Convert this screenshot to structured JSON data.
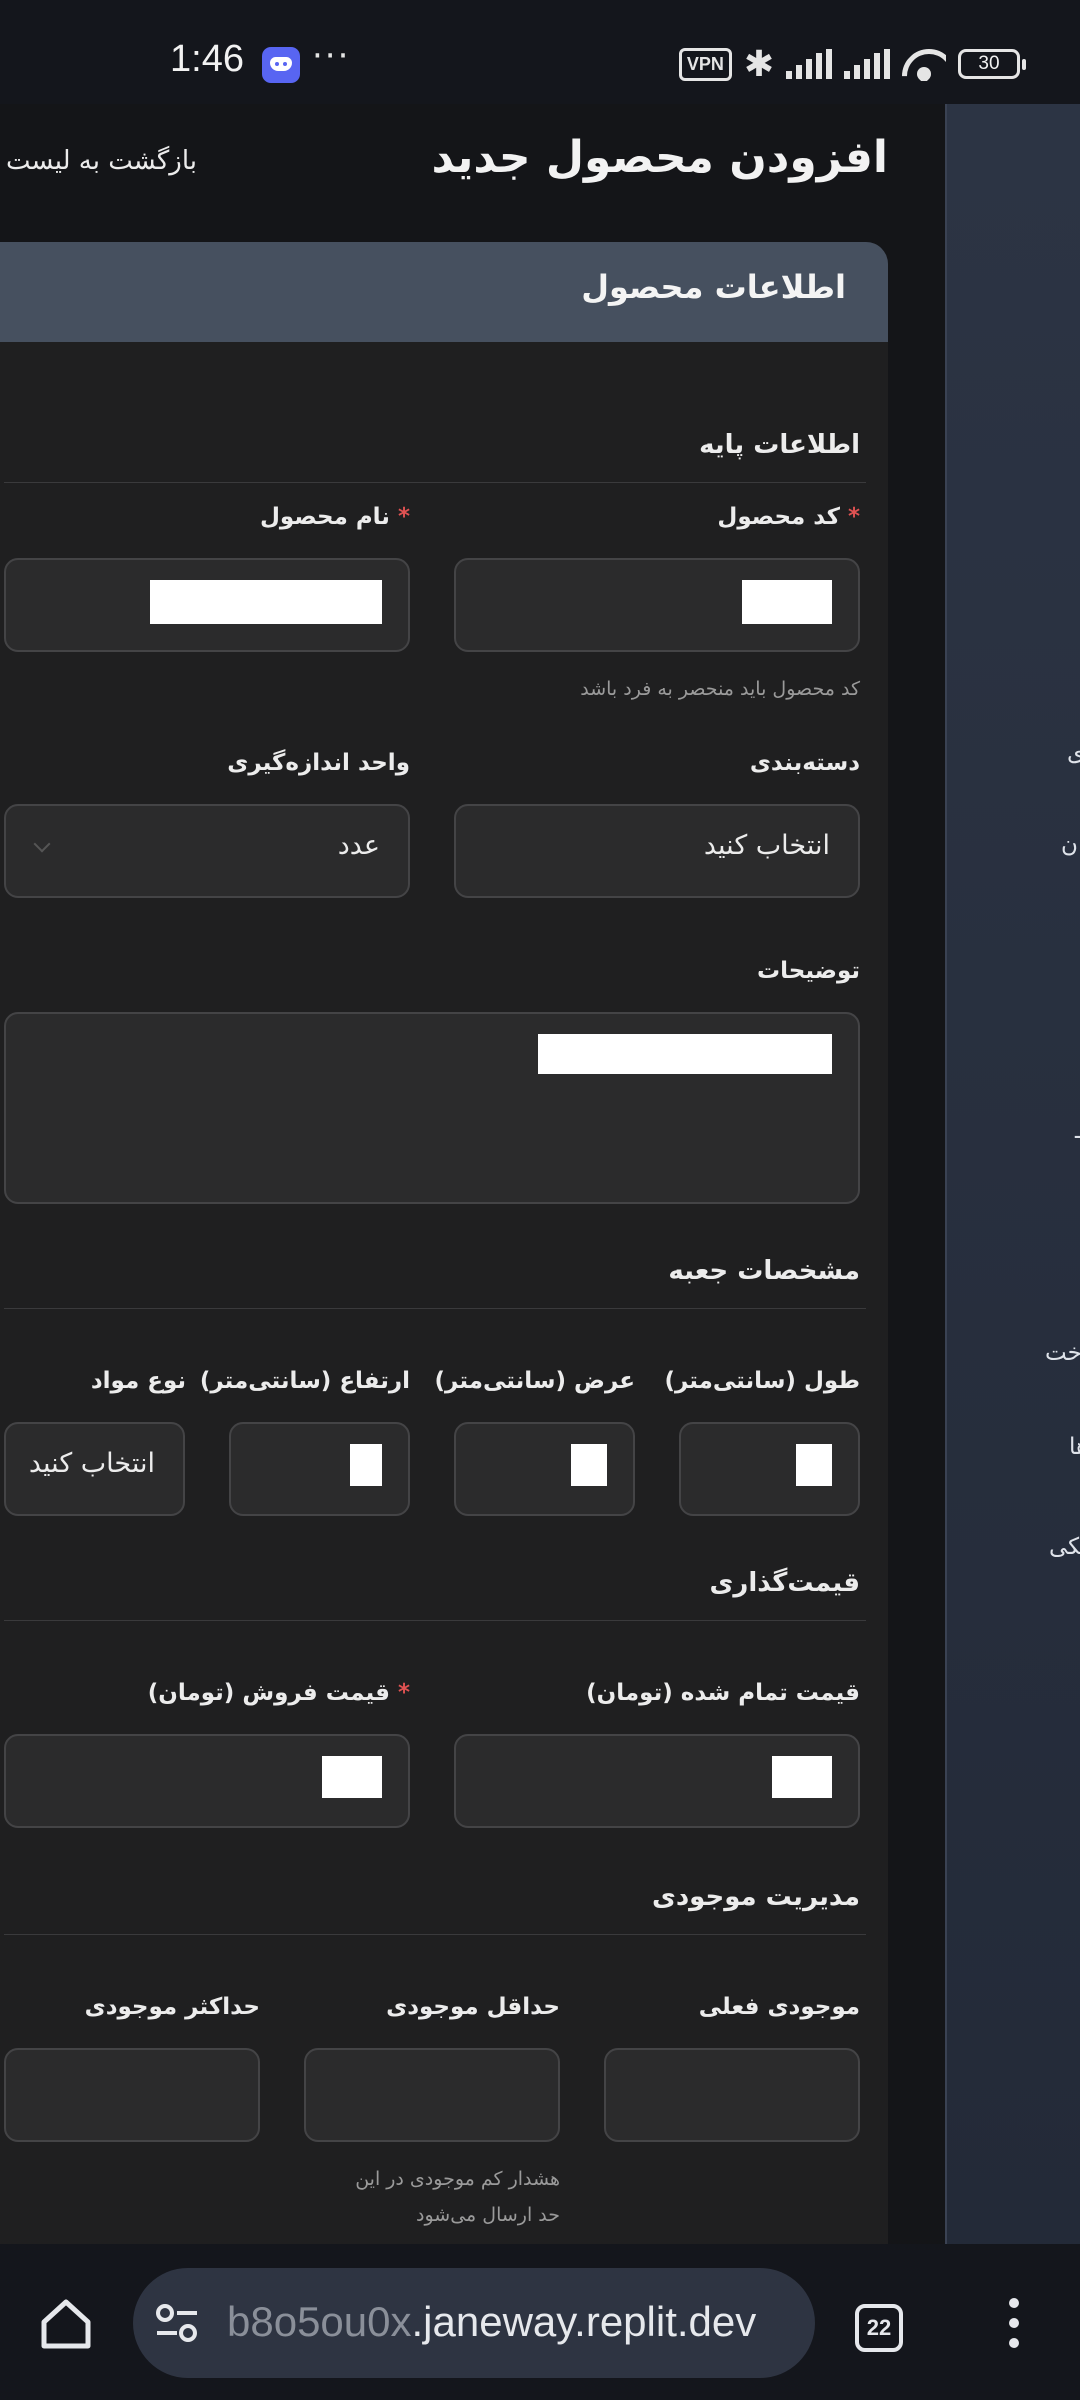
{
  "status_bar": {
    "time": "1:46",
    "more": "···",
    "vpn": "VPN",
    "battery": "30",
    "icons": [
      "discord-icon",
      "vpn-icon",
      "bluetooth-icon",
      "signal-icon",
      "wifi-icon",
      "battery-icon"
    ]
  },
  "header": {
    "title": "افزودن محصول جدید",
    "back_link": "بازگشت به لیست"
  },
  "card": {
    "title": "اطلاعات محصول"
  },
  "sections": {
    "basic": {
      "title": "اطلاعات پایه",
      "code_label": "کد محصول",
      "name_label": "نام محصول",
      "required_mark": "*",
      "code_hint": "کد محصول باید منحصر به فرد باشد",
      "category_label": "دسته‌بندی",
      "category_value": "انتخاب کنید",
      "unit_label": "واحد اندازه‌گیری",
      "unit_value": "عدد",
      "description_label": "توضیحات"
    },
    "box": {
      "title": "مشخصات جعبه",
      "length_label": "طول (سانتی‌متر)",
      "width_label": "عرض (سانتی‌متر)",
      "height_label": "ارتفاع (سانتی‌متر)",
      "material_label": "نوع مواد",
      "material_value": "انتخاب کنید"
    },
    "pricing": {
      "title": "قیمت‌گذاری",
      "cost_label": "قیمت تمام شده (تومان)",
      "sale_label": "قیمت فروش (تومان)"
    },
    "inventory": {
      "title": "مدیریت موجودی",
      "current_label": "موجودی فعلی",
      "min_label": "حداقل موجودی",
      "max_label": "حداکثر موجودی",
      "min_hint_1": "هشدار کم موجودی در این",
      "min_hint_2": "حد ارسال می‌شود"
    }
  },
  "side_fragments": [
    "ی",
    "ان",
    "ـ",
    "خت",
    "ها",
    "نکی"
  ],
  "browser": {
    "url_dim": "b8o5ou0x",
    "url_main": ".janeway.replit.dev",
    "tab_count": "22"
  },
  "colors": {
    "background": "#141518",
    "card": "#1f1f20",
    "card_header": "#46505f",
    "field": "#2b2b2c",
    "required": "#e05252",
    "side_panel": "#2c3444"
  }
}
